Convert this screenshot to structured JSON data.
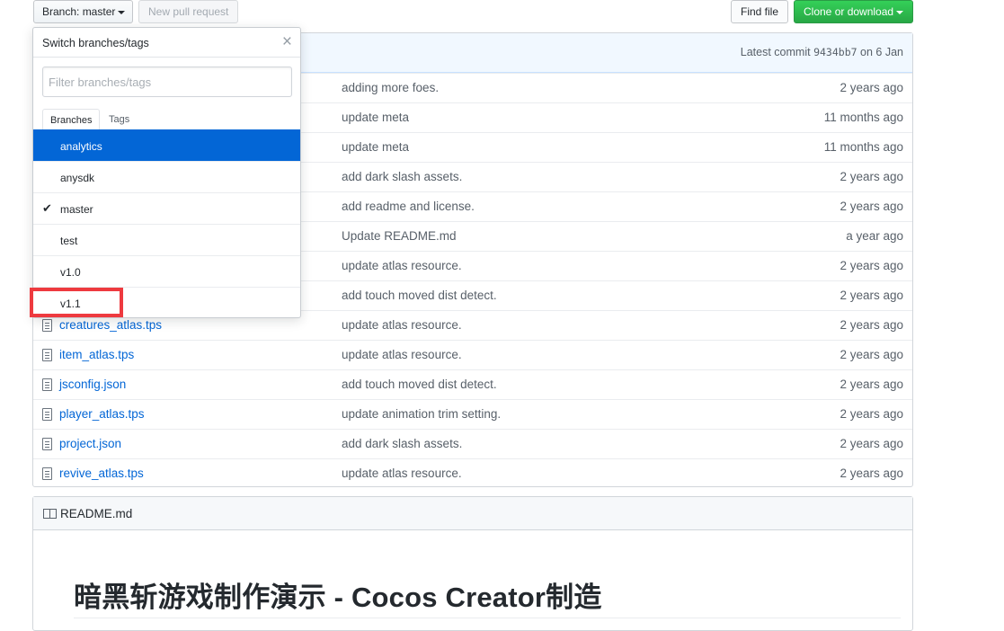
{
  "toolbar": {
    "branch_label": "Branch: master",
    "new_pull_request": "New pull request",
    "find_file": "Find file",
    "clone_download": "Clone or download"
  },
  "commit_bar": {
    "prefix": "Latest commit",
    "sha": "9434bb7",
    "date": "on 6 Jan"
  },
  "files": [
    {
      "name": "",
      "message": "adding more foes.",
      "age": "2 years ago"
    },
    {
      "name": "",
      "message": "update meta",
      "age": "11 months ago"
    },
    {
      "name": "",
      "message": "update meta",
      "age": "11 months ago"
    },
    {
      "name": "",
      "message": "add dark slash assets.",
      "age": "2 years ago"
    },
    {
      "name": "",
      "message": "add readme and license.",
      "age": "2 years ago"
    },
    {
      "name": "",
      "message": "Update README.md",
      "age": "a year ago"
    },
    {
      "name": "",
      "message": "update atlas resource.",
      "age": "2 years ago"
    },
    {
      "name": "",
      "message": "add touch moved dist detect.",
      "age": "2 years ago"
    },
    {
      "name": "creatures_atlas.tps",
      "message": "update atlas resource.",
      "age": "2 years ago"
    },
    {
      "name": "item_atlas.tps",
      "message": "update atlas resource.",
      "age": "2 years ago"
    },
    {
      "name": "jsconfig.json",
      "message": "add touch moved dist detect.",
      "age": "2 years ago"
    },
    {
      "name": "player_atlas.tps",
      "message": "update animation trim setting.",
      "age": "2 years ago"
    },
    {
      "name": "project.json",
      "message": "add dark slash assets.",
      "age": "2 years ago"
    },
    {
      "name": "revive_atlas.tps",
      "message": "update atlas resource.",
      "age": "2 years ago"
    }
  ],
  "readme": {
    "filename": "README.md",
    "heading": "暗黑斩游戏制作演示 - Cocos Creator制造"
  },
  "branch_dropdown": {
    "title": "Switch branches/tags",
    "close_glyph": "×",
    "filter_placeholder": "Filter branches/tags",
    "tabs": [
      "Branches",
      "Tags"
    ],
    "check_glyph": "✔",
    "items": [
      {
        "label": "analytics",
        "state": "highlighted"
      },
      {
        "label": "anysdk",
        "state": ""
      },
      {
        "label": "master",
        "state": "checked"
      },
      {
        "label": "test",
        "state": ""
      },
      {
        "label": "v1.0",
        "state": ""
      },
      {
        "label": "v1.1",
        "state": ""
      }
    ]
  },
  "colors": {
    "link": "#0366d6",
    "clone_button": "#28a745",
    "highlight_box": "#ee3a3f"
  }
}
